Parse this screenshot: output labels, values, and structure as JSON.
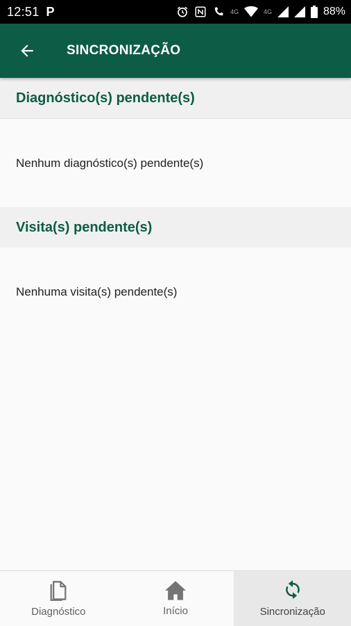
{
  "status_bar": {
    "time": "12:51",
    "p_icon": "P",
    "network_label": "4G",
    "network_label2": "4G",
    "battery": "88%"
  },
  "app_bar": {
    "title": "SINCRONIZAÇÃO",
    "back_icon": "arrow-left-icon"
  },
  "sections": [
    {
      "title": "Diagnóstico(s) pendente(s)",
      "message": "Nenhum diagnóstico(s) pendente(s)"
    },
    {
      "title": "Visita(s) pendente(s)",
      "message": "Nenhuma visita(s) pendente(s)"
    }
  ],
  "bottom_nav": {
    "items": [
      {
        "label": "Diagnóstico",
        "icon": "document-icon"
      },
      {
        "label": "Início",
        "icon": "home-icon"
      },
      {
        "label": "Sincronização",
        "icon": "sync-icon",
        "active": true
      }
    ]
  },
  "colors": {
    "primary": "#0d5c45",
    "header_bg": "#f0f0f0",
    "page_bg": "#fafafa"
  }
}
